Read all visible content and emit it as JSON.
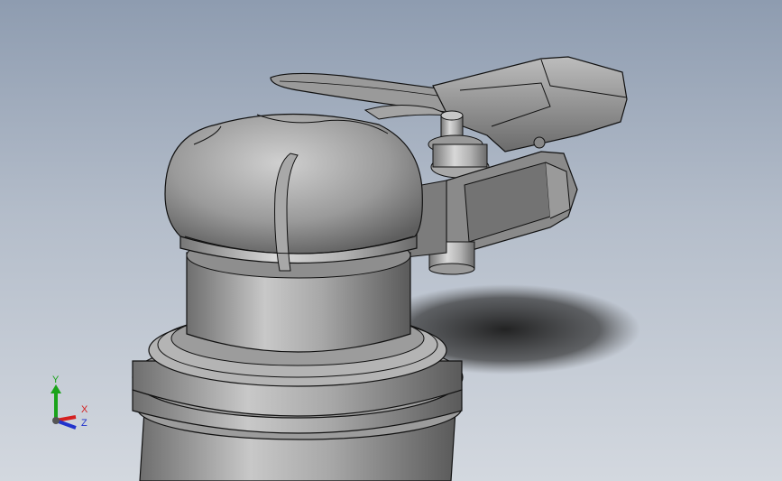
{
  "viewport": {
    "background_top": "#8e9cb0",
    "background_bottom": "#d3d8df"
  },
  "model": {
    "body_color": "#8c8c8c",
    "edge_color": "#111111"
  },
  "triad": {
    "y_label": "Y",
    "x_label": "X",
    "z_label": "Z",
    "y_color": "#1aa31a",
    "x_color": "#d42020",
    "z_color": "#2233cc"
  }
}
